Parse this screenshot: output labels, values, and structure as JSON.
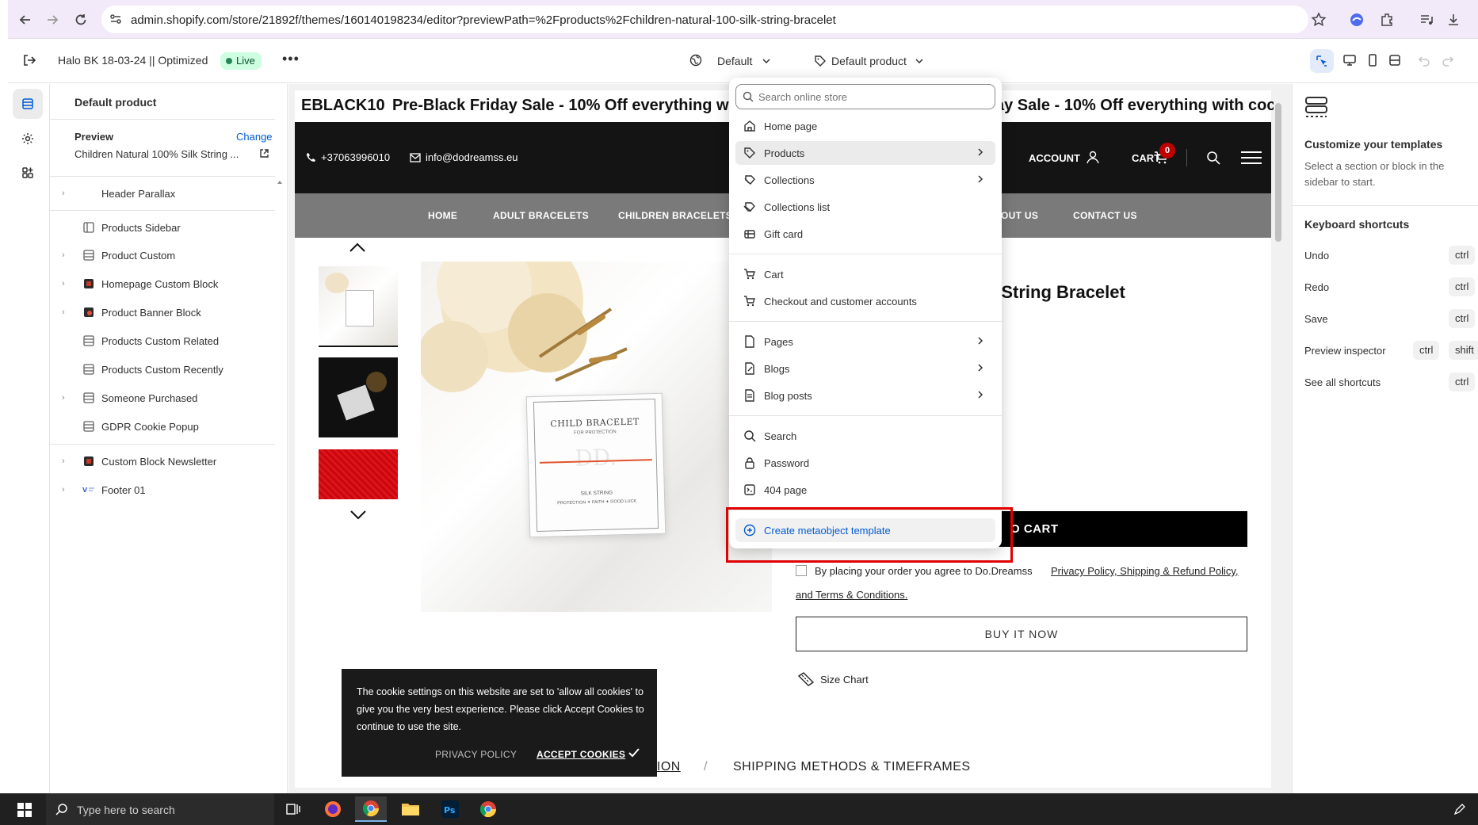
{
  "browser": {
    "url": "admin.shopify.com/store/21892f/themes/160140198234/editor?previewPath=%2Fproducts%2Fchildren-natural-100-silk-string-bracelet"
  },
  "editor": {
    "theme_name": "Halo BK 18-03-24 || Optimized",
    "live_badge": "Live",
    "more_label": "•••",
    "template_select": "Default",
    "product_select": "Default product"
  },
  "sidebar": {
    "title": "Default product",
    "preview_label": "Preview",
    "change_label": "Change",
    "preview_value": "Children Natural 100% Silk String ...",
    "items": [
      {
        "label": "Header Parallax",
        "has_chevron": true
      },
      {
        "label": "Products Sidebar",
        "has_chevron": false
      },
      {
        "label": "Product Custom",
        "has_chevron": true
      },
      {
        "label": "Homepage Custom Block",
        "has_chevron": true
      },
      {
        "label": "Product Banner Block",
        "has_chevron": true
      },
      {
        "label": "Products Custom Related",
        "has_chevron": false
      },
      {
        "label": "Products Custom Recently",
        "has_chevron": false
      },
      {
        "label": "Someone Purchased",
        "has_chevron": true
      },
      {
        "label": "GDPR Cookie Popup",
        "has_chevron": false
      },
      {
        "label": "Custom Block Newsletter",
        "has_chevron": true
      },
      {
        "label": "Footer 01",
        "has_chevron": true
      }
    ]
  },
  "store": {
    "announce_code": "EBLACK10",
    "announce_text": "Pre-Black Friday Sale - 10% Off everything with",
    "announce_text_right": "ay Sale - 10% Off everything with coc",
    "phone": "+37063996010",
    "email": "info@dodreamss.eu",
    "account": "ACCOUNT",
    "cart": "CART",
    "cart_count": "0",
    "nav": [
      "HOME",
      "ADULT BRACELETS",
      "CHILDREN BRACELETS",
      "OUT US",
      "CONTACT US"
    ],
    "card_title": "CHILD BRACELET",
    "card_sub": "FOR PROTECTION",
    "card_bottom1": "SILK STRING",
    "card_bottom2": "PROTECTION ✦ FAITH ✦ GOOD LUCK",
    "card_monogram": "DD.",
    "product_title": "k String Bracelet",
    "add_to_cart": "O CART",
    "agree_text": "By placing your order you agree to Do.Dreamss",
    "agree_links": "Privacy Policy, Shipping & Refund Policy,",
    "agree_terms": "and Terms & Conditions.",
    "buy_now": "BUY IT NOW",
    "size_chart": "Size Chart",
    "tab_description": "DESCRIPTION",
    "tab_separator": "/",
    "tab_shipping": "SHIPPING METHODS & TIMEFRAMES"
  },
  "cookie": {
    "text": "The cookie settings on this website are set to 'allow all cookies' to give you the very best experience. Please click Accept Cookies to continue to use the site.",
    "privacy": "PRIVACY POLICY",
    "accept": "ACCEPT COOKIES"
  },
  "dropdown": {
    "search_placeholder": "Search online store",
    "create_label": "Create metaobject template",
    "groups": [
      [
        {
          "label": "Home page",
          "icon": "home-icon",
          "chevron": false,
          "active": false
        },
        {
          "label": "Products",
          "icon": "tag-icon",
          "chevron": true,
          "active": true
        },
        {
          "label": "Collections",
          "icon": "collection-icon",
          "chevron": true,
          "active": false
        },
        {
          "label": "Collections list",
          "icon": "collection-list-icon",
          "chevron": false,
          "active": false
        },
        {
          "label": "Gift card",
          "icon": "gift-card-icon",
          "chevron": false,
          "active": false
        }
      ],
      [
        {
          "label": "Cart",
          "icon": "cart-icon",
          "chevron": false,
          "active": false
        },
        {
          "label": "Checkout and customer accounts",
          "icon": "checkout-icon",
          "chevron": false,
          "active": false
        }
      ],
      [
        {
          "label": "Pages",
          "icon": "page-icon",
          "chevron": true,
          "active": false
        },
        {
          "label": "Blogs",
          "icon": "blog-icon",
          "chevron": true,
          "active": false
        },
        {
          "label": "Blog posts",
          "icon": "blog-post-icon",
          "chevron": true,
          "active": false
        }
      ],
      [
        {
          "label": "Search",
          "icon": "search-icon",
          "chevron": false,
          "active": false
        },
        {
          "label": "Password",
          "icon": "lock-icon",
          "chevron": false,
          "active": false
        },
        {
          "label": "404 page",
          "icon": "error-page-icon",
          "chevron": false,
          "active": false
        }
      ]
    ]
  },
  "right_panel": {
    "title": "Customize your templates",
    "description": "Select a section or block in the sidebar to start.",
    "shortcuts_title": "Keyboard shortcuts",
    "shortcuts": [
      {
        "name": "Undo",
        "keys": [
          "ctrl"
        ]
      },
      {
        "name": "Redo",
        "keys": [
          "ctrl"
        ]
      },
      {
        "name": "Save",
        "keys": [
          "ctrl"
        ]
      },
      {
        "name": "Preview inspector",
        "keys": [
          "ctrl",
          "shift"
        ]
      },
      {
        "name": "See all shortcuts",
        "keys": [
          "ctrl"
        ]
      }
    ]
  },
  "taskbar": {
    "search_placeholder": "Type here to search"
  },
  "colors": {
    "accent_blue": "#005bd3",
    "live_green": "#29845a",
    "highlight_red": "#e00000",
    "store_header": "#141414",
    "store_nav": "#7a7a7a"
  }
}
